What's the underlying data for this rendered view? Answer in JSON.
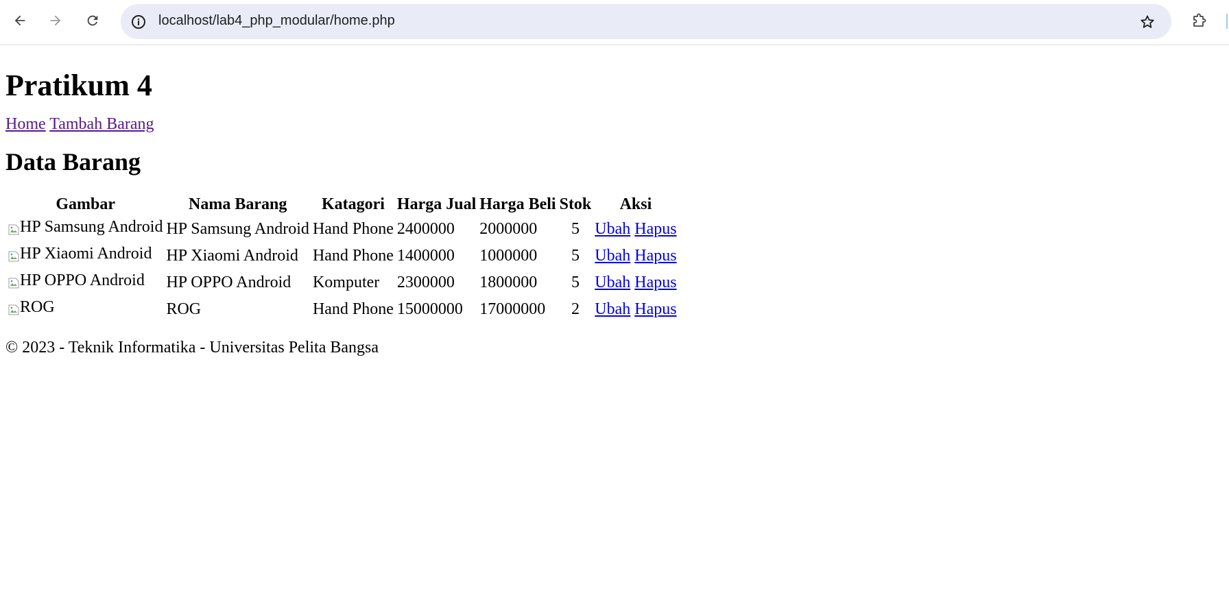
{
  "browser": {
    "url": "localhost/lab4_php_modular/home.php",
    "icons": [
      "back-arrow-icon",
      "forward-arrow-icon",
      "reload-icon",
      "site-info-icon",
      "bookmark-star-icon",
      "extensions-icon"
    ]
  },
  "page": {
    "title": "Pratikum 4",
    "nav": {
      "home": "Home",
      "tambah": "Tambah Barang"
    },
    "section_title": "Data Barang",
    "table": {
      "headers": [
        "Gambar",
        "Nama Barang",
        "Katagori",
        "Harga Jual",
        "Harga Beli",
        "Stok",
        "Aksi"
      ],
      "rows": [
        {
          "gambar_alt": "HP Samsung Android",
          "nama": "HP Samsung Android",
          "kategori": "Hand Phone",
          "harga_jual": "2400000",
          "harga_beli": "2000000",
          "stok": "5",
          "ubah": "Ubah",
          "hapus": "Hapus"
        },
        {
          "gambar_alt": "HP Xiaomi Android",
          "nama": "HP Xiaomi Android",
          "kategori": "Hand Phone",
          "harga_jual": "1400000",
          "harga_beli": "1000000",
          "stok": "5",
          "ubah": "Ubah",
          "hapus": "Hapus"
        },
        {
          "gambar_alt": "HP OPPO Android",
          "nama": "HP OPPO Android",
          "kategori": "Komputer",
          "harga_jual": "2300000",
          "harga_beli": "1800000",
          "stok": "5",
          "ubah": "Ubah",
          "hapus": "Hapus"
        },
        {
          "gambar_alt": "ROG",
          "nama": "ROG",
          "kategori": "Hand Phone",
          "harga_jual": "15000000",
          "harga_beli": "17000000",
          "stok": "2",
          "ubah": "Ubah",
          "hapus": "Hapus"
        }
      ]
    },
    "footer": "© 2023 - Teknik Informatika - Universitas Pelita Bangsa"
  },
  "colors": {
    "visited_link": "#551a8b",
    "link": "#0000ee",
    "omnibox_bg": "#e9ebf6"
  }
}
